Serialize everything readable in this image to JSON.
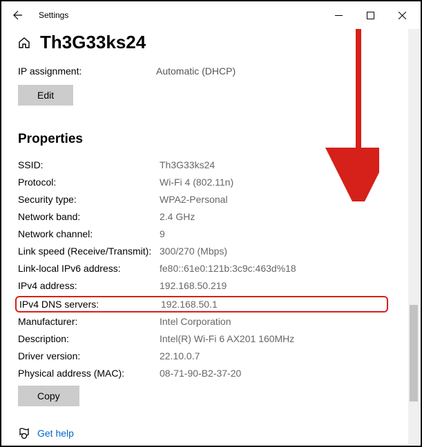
{
  "window": {
    "title": "Settings",
    "name": "Th3G33ks24"
  },
  "ip_assignment": {
    "label": "IP assignment:",
    "value": "Automatic (DHCP)"
  },
  "buttons": {
    "edit": "Edit",
    "copy": "Copy"
  },
  "section": {
    "properties": "Properties"
  },
  "props": [
    {
      "label": "SSID:",
      "value": "Th3G33ks24"
    },
    {
      "label": "Protocol:",
      "value": "Wi-Fi 4 (802.11n)"
    },
    {
      "label": "Security type:",
      "value": "WPA2-Personal"
    },
    {
      "label": "Network band:",
      "value": "2.4 GHz"
    },
    {
      "label": "Network channel:",
      "value": "9"
    },
    {
      "label": "Link speed (Receive/Transmit):",
      "value": "300/270 (Mbps)"
    },
    {
      "label": "Link-local IPv6 address:",
      "value": "fe80::61e0:121b:3c9c:463d%18"
    },
    {
      "label": "IPv4 address:",
      "value": "192.168.50.219"
    },
    {
      "label": "IPv4 DNS servers:",
      "value": "192.168.50.1",
      "highlight": true
    },
    {
      "label": "Manufacturer:",
      "value": "Intel Corporation"
    },
    {
      "label": "Description:",
      "value": "Intel(R) Wi-Fi 6 AX201 160MHz"
    },
    {
      "label": "Driver version:",
      "value": "22.10.0.7"
    },
    {
      "label": "Physical address (MAC):",
      "value": "08-71-90-B2-37-20"
    }
  ],
  "help": {
    "label": "Get help"
  },
  "annotation": {
    "arrow_color": "#d6201a"
  }
}
